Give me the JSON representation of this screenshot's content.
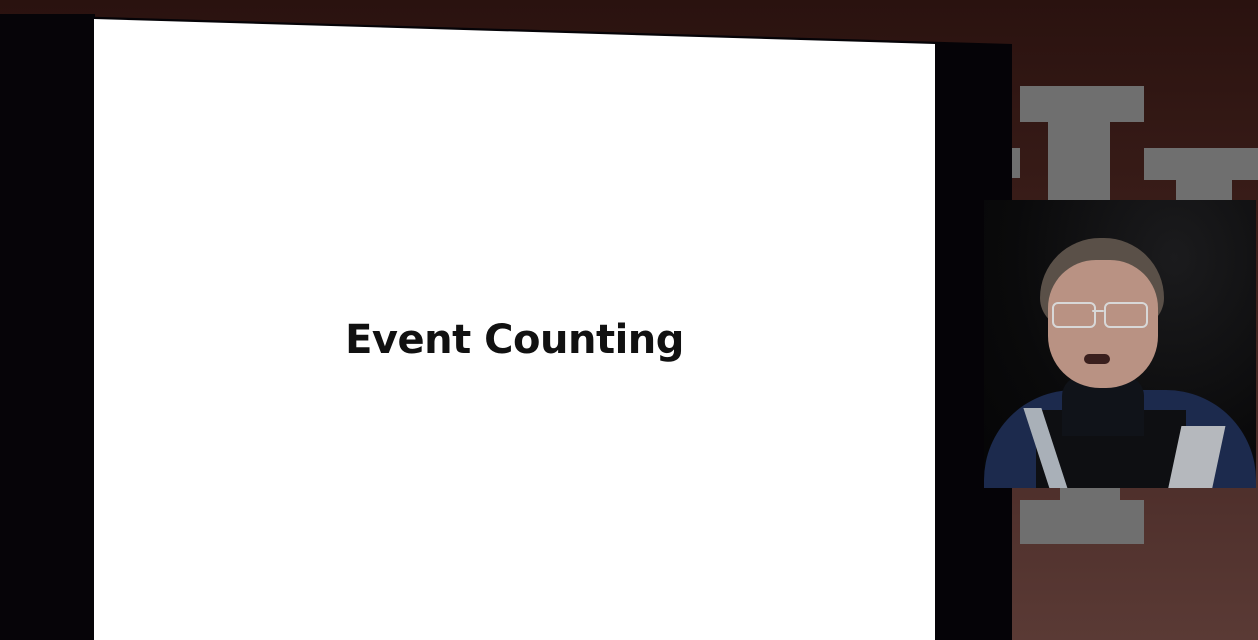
{
  "slide": {
    "title": "Event Counting"
  },
  "webcam": {
    "label": "presenter-video"
  },
  "colors": {
    "slide_background": "#ffffff",
    "slide_text": "#111111",
    "room_background": "#3a1d19",
    "logo_gray": "#6f6f6f"
  }
}
